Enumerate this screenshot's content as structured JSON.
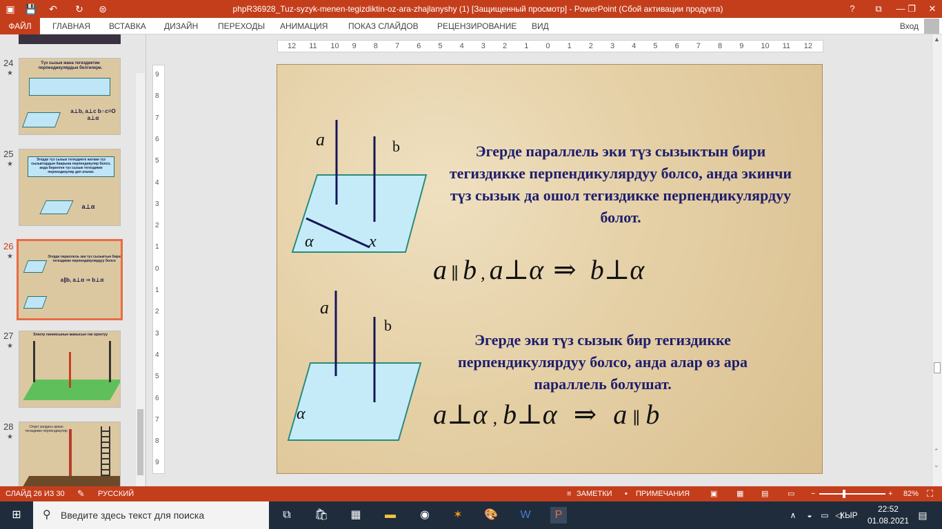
{
  "window": {
    "title": "phpR36928_Tuz-syzyk-menen-tegizdiktin-oz-ara-zhajlanyshy (1) [Защищенный просмотр] -  PowerPoint (Сбой активации продукта)",
    "help": "?",
    "restore": "⧉",
    "minimize": "—",
    "maximize": "❐",
    "close": "✕"
  },
  "quick_access": {
    "save_icon": "💾",
    "undo_icon": "↶",
    "redo_icon": "↻",
    "customize_icon": "⊜"
  },
  "ribbon": {
    "tabs": [
      "ФАЙЛ",
      "ГЛАВНАЯ",
      "ВСТАВКА",
      "ДИЗАЙН",
      "ПЕРЕХОДЫ",
      "АНИМАЦИЯ",
      "ПОКАЗ СЛАЙДОВ",
      "РЕЦЕНЗИРОВАНИЕ",
      "ВИД"
    ],
    "login": "Вход"
  },
  "thumbnails": [
    {
      "number": "24",
      "star": "★",
      "title": "Түз сызык жана тегиздиктин перпендикулярдык белгилери.",
      "formula": "a⊥b, a⊥c  b∩c=O  a⊥α"
    },
    {
      "number": "25",
      "star": "★",
      "title": "Эгерде түз сызык тегиздикте жаткан түз сызыктардын баарына перпендикуляр болсо, анда берилген түз сызык тегиздикке перпендикуляр деп аталат.",
      "formula": "a⊥α"
    },
    {
      "number": "26",
      "star": "★",
      "title": "Эгерде параллель эки түз сызыктын бири тегиздикке перпендикулярдуу болсо",
      "formula": "a∥b, a⊥α ⇒ b⊥α"
    },
    {
      "number": "27",
      "star": "★",
      "title": "Электр линиясынын мамысын тик орнотуу"
    },
    {
      "number": "28",
      "star": "★",
      "title": "Спорт залдагы аркан тегиздикке перпендикуляр"
    }
  ],
  "ruler": {
    "h_labels": [
      "12",
      "11",
      "10",
      "9",
      "8",
      "7",
      "6",
      "5",
      "4",
      "3",
      "2",
      "1",
      "0",
      "1",
      "2",
      "3",
      "4",
      "5",
      "6",
      "7",
      "8",
      "9",
      "10",
      "11",
      "12"
    ],
    "v_labels": [
      "9",
      "8",
      "7",
      "6",
      "5",
      "4",
      "3",
      "2",
      "1",
      "0",
      "1",
      "2",
      "3",
      "4",
      "5",
      "6",
      "7",
      "8",
      "9"
    ]
  },
  "slide": {
    "text1": "Эгерде параллель эки түз сызыктын бири тегиздикке перпендикулярдуу болсо, анда экинчи түз сызык да ошол тегиздикке перпендикулярдуу болот.",
    "formula1_parts": [
      "a",
      "∥",
      "b",
      ",",
      "a",
      "⊥",
      "α",
      "⇒",
      "b",
      "⊥",
      "α"
    ],
    "text2": "Эгерде эки түз сызык бир тегиздикке перпендикулярдуу болсо, анда алар өз ара параллель болушат.",
    "formula2_parts": [
      "a",
      "⊥",
      "α",
      ",",
      "b",
      "⊥",
      "α",
      "⇒",
      "a",
      "∥",
      "b"
    ],
    "fig1_labels": {
      "a": "a",
      "b": "b",
      "alpha": "α",
      "x": "x"
    },
    "fig2_labels": {
      "a": "a",
      "b": "b",
      "alpha": "α"
    },
    "plane_fill": "#c5ebf8",
    "plane_stroke": "#2a8a7a",
    "line_color": "#15155a",
    "text_color": "#1e1e6e"
  },
  "statusbar": {
    "slide_info": "СЛАЙД 26 ИЗ 30",
    "language": "РУССКИЙ",
    "notes": "ЗАМЕТКИ",
    "comments": "ПРИМЕЧАНИЯ",
    "zoom": "82%",
    "zoom_minus": "−",
    "zoom_plus": "+"
  },
  "taskbar": {
    "search_placeholder": "Введите здесь текст для поиска",
    "language": "КЫР",
    "time": "22:52",
    "date": "01.08.2021"
  }
}
